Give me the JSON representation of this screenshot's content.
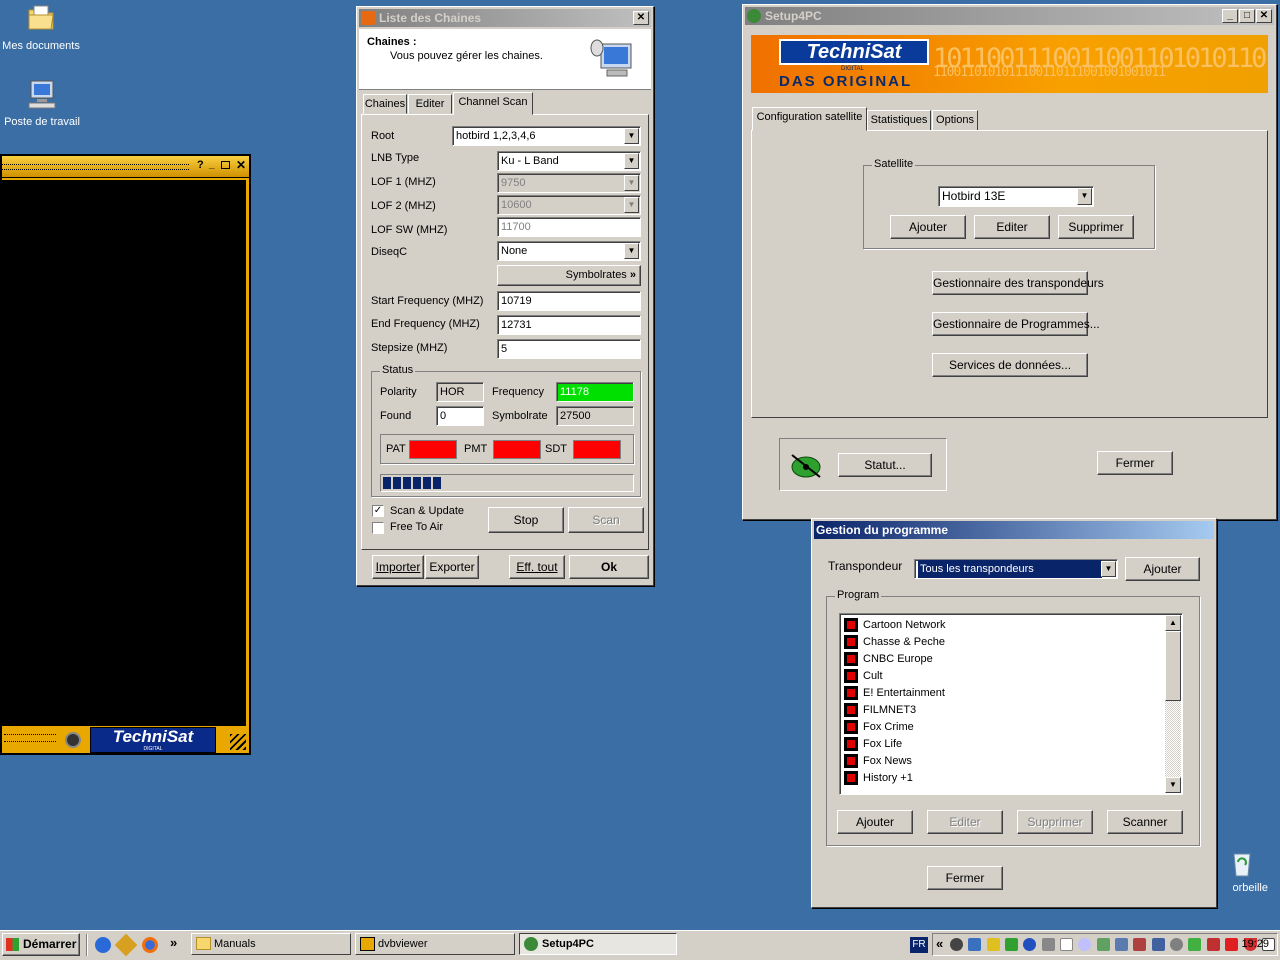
{
  "desktop": {
    "icons": [
      {
        "label": "Mes documents"
      },
      {
        "label": "Poste de travail"
      },
      {
        "label": "orbeille"
      }
    ]
  },
  "player": {
    "logo": "TechniSat",
    "logo_sub": "DIGITAL"
  },
  "channels_window": {
    "title": "Liste des Chaines",
    "header_title": "Chaines :",
    "header_desc": "Vous pouvez gérer les chaines.",
    "tabs": [
      "Chaines",
      "Editer",
      "Channel Scan"
    ],
    "root_label": "Root",
    "root_value": "hotbird 1,2,3,4,6",
    "lnb_label": "LNB Type",
    "lnb_value": "Ku - L Band",
    "lof1_label": "LOF 1 (MHZ)",
    "lof1_value": "9750",
    "lof2_label": "LOF 2 (MHZ)",
    "lof2_value": "10600",
    "lofsw_label": "LOF SW (MHZ)",
    "lofsw_value": "11700",
    "diseqc_label": "DiseqC",
    "diseqc_value": "None",
    "symbolrates_button": "Symbolrates",
    "start_label": "Start Frequency (MHZ)",
    "start_value": "10719",
    "end_label": "End  Frequency (MHZ)",
    "end_value": "12731",
    "step_label": "Stepsize (MHZ)",
    "step_value": "5",
    "status_group": "Status",
    "polarity_label": "Polarity",
    "polarity_value": "HOR",
    "frequency_label": "Frequency",
    "frequency_value": "11178",
    "found_label": "Found",
    "found_value": "0",
    "symbolrate_label": "Symbolrate",
    "symbolrate_value": "27500",
    "pat_label": "PAT",
    "pmt_label": "PMT",
    "sdt_label": "SDT",
    "progress_segments": 6,
    "scan_update_label": "Scan & Update",
    "scan_update_checked": true,
    "free_to_air_label": "Free To Air",
    "free_to_air_checked": false,
    "stop_button": "Stop",
    "scan_button": "Scan",
    "import_button": "Importer",
    "export_button": "Exporter",
    "clear_button": "Eff. tout",
    "ok_button": "Ok"
  },
  "setup_window": {
    "title": "Setup4PC",
    "banner_logo": "TechniSat",
    "banner_sub": "DIGITAL",
    "banner_slogan": "DAS ORIGINAL",
    "banner_binary_1": "1011001110011001101010110",
    "banner_binary_2": "1100110101011100110111001001001011",
    "tabs": [
      "Configuration satellite",
      "Statistiques",
      "Options"
    ],
    "satellite_group": "Satellite",
    "satellite_value": "Hotbird 13E",
    "add_button": "Ajouter",
    "edit_button": "Editer",
    "delete_button": "Supprimer",
    "transponders_button": "Gestionnaire des transpondeurs",
    "programs_button": "Gestionnaire de Programmes...",
    "data_services_button": "Services de données...",
    "status_button": "Statut...",
    "close_button": "Fermer"
  },
  "program_window": {
    "title": "Gestion du programme",
    "transponder_label": "Transpondeur",
    "transponder_value": "Tous les transpondeurs",
    "add_top_button": "Ajouter",
    "program_group": "Program",
    "programs": [
      "Cartoon Network",
      "Chasse & Peche",
      "CNBC Europe",
      "Cult",
      "E! Entertainment",
      "FILMNET3",
      "Fox Crime",
      "Fox Life",
      "Fox News",
      "History +1"
    ],
    "add_button": "Ajouter",
    "edit_button": "Editer",
    "delete_button": "Supprimer",
    "scan_button": "Scanner",
    "close_button": "Fermer"
  },
  "taskbar": {
    "start_label": "Démarrer",
    "quick_chevron": "»",
    "tasks": [
      "Manuals",
      "dvbviewer",
      "Setup4PC"
    ],
    "lang": "FR",
    "tray_chevron": "«",
    "clock": "19:29"
  }
}
